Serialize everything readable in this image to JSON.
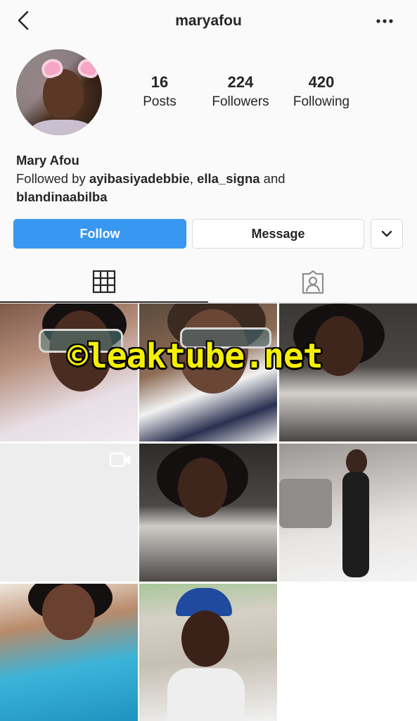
{
  "header": {
    "username": "maryafou",
    "back_icon": "chevron-left-icon",
    "more_icon": "more-horizontal-icon"
  },
  "profile": {
    "display_name": "Mary Afou",
    "followed_by_prefix": "Followed by ",
    "followers_1": "ayibasiyadebbie",
    "separator": ", ",
    "followers_2": "ella_signa",
    "conjunction": " and",
    "followers_3": "blandinaabilba"
  },
  "stats": [
    {
      "value": "16",
      "label": "Posts"
    },
    {
      "value": "224",
      "label": "Followers"
    },
    {
      "value": "420",
      "label": "Following"
    }
  ],
  "actions": {
    "follow_label": "Follow",
    "message_label": "Message",
    "dropdown_icon": "chevron-down-icon"
  },
  "tabs": [
    {
      "name": "grid",
      "icon": "grid-icon",
      "active": true
    },
    {
      "name": "tagged",
      "icon": "tagged-person-icon",
      "active": false
    }
  ],
  "watermark": "©leaktube.net",
  "colors": {
    "follow_blue": "#3897f0",
    "text": "#262626",
    "border": "#dbdbdb",
    "watermark_yellow": "#f5f000"
  }
}
